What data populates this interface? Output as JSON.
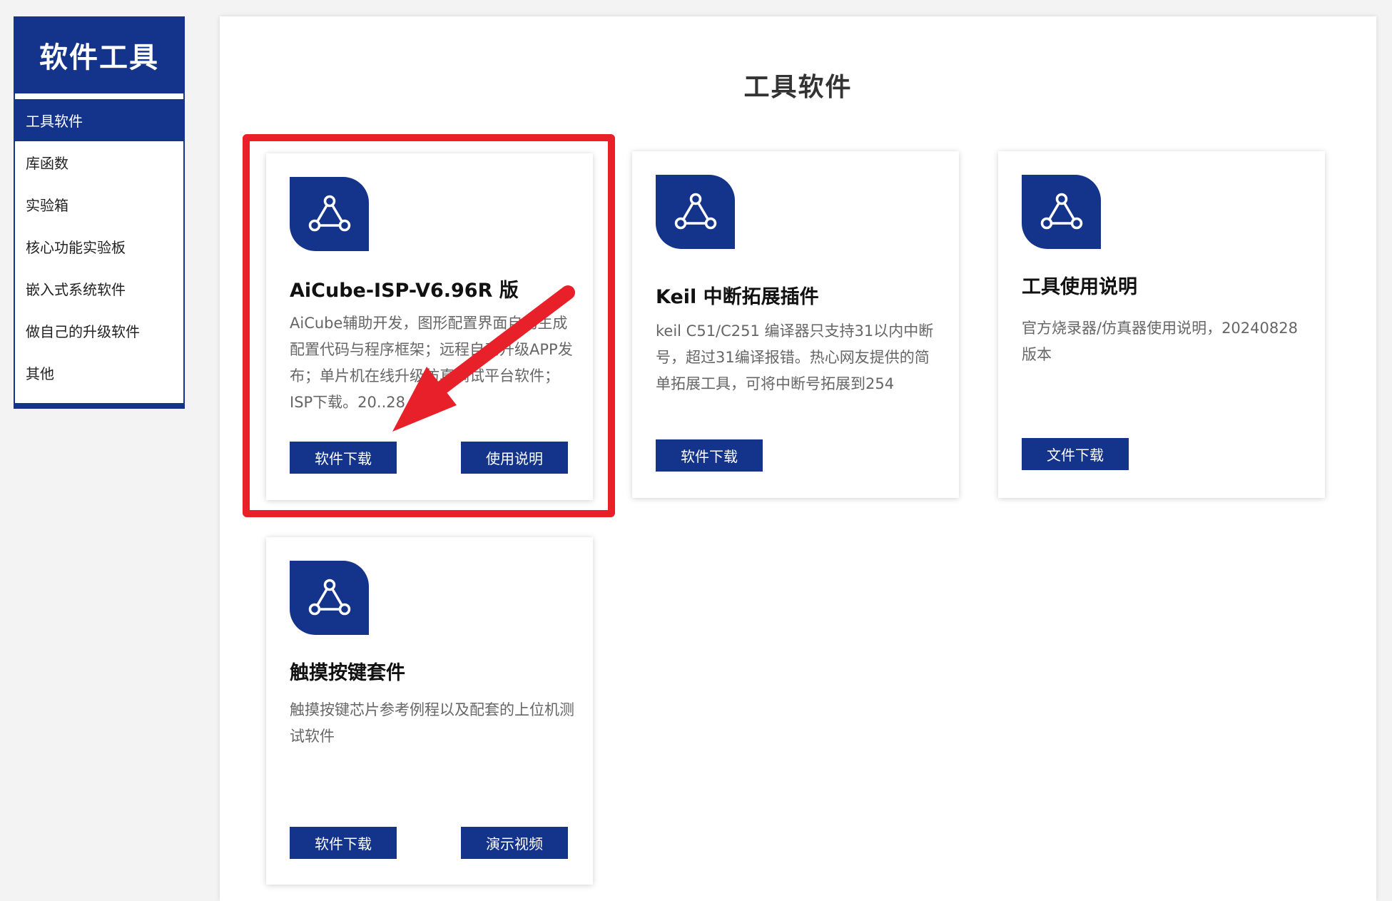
{
  "sidebar": {
    "title": "软件工具",
    "items": [
      {
        "label": "工具软件",
        "active": true
      },
      {
        "label": "库函数",
        "active": false
      },
      {
        "label": "实验箱",
        "active": false
      },
      {
        "label": "核心功能实验板",
        "active": false
      },
      {
        "label": "嵌入式系统软件",
        "active": false
      },
      {
        "label": "做自己的升级软件",
        "active": false
      },
      {
        "label": "其他",
        "active": false
      }
    ]
  },
  "main": {
    "title": "工具软件",
    "cards": [
      {
        "icon": "network-triangle-icon",
        "title": "AiCube-ISP-V6.96R 版",
        "description": "AiCube辅助开发，图形配置界面自动生成配置代码与程序框架；远程自动升级APP发布；单片机在线升级仿真调试平台软件；ISP下载。20..28",
        "buttons": [
          "软件下载",
          "使用说明"
        ]
      },
      {
        "icon": "network-triangle-icon",
        "title": "Keil 中断拓展插件",
        "description": "keil C51/C251 编译器只支持31以内中断号，超过31编译报错。热心网友提供的简单拓展工具，可将中断号拓展到254",
        "buttons": [
          "软件下载"
        ]
      },
      {
        "icon": "network-triangle-icon",
        "title": "工具使用说明",
        "description": "官方烧录器/仿真器使用说明，20240828版本",
        "buttons": [
          "文件下载"
        ]
      },
      {
        "icon": "network-triangle-icon",
        "title": "触摸按键套件",
        "description": "触摸按键芯片参考例程以及配套的上位机测试软件",
        "buttons": [
          "软件下载",
          "演示视频"
        ]
      }
    ]
  },
  "colors": {
    "brand": "#13348a",
    "annotation": "#e8202a"
  }
}
